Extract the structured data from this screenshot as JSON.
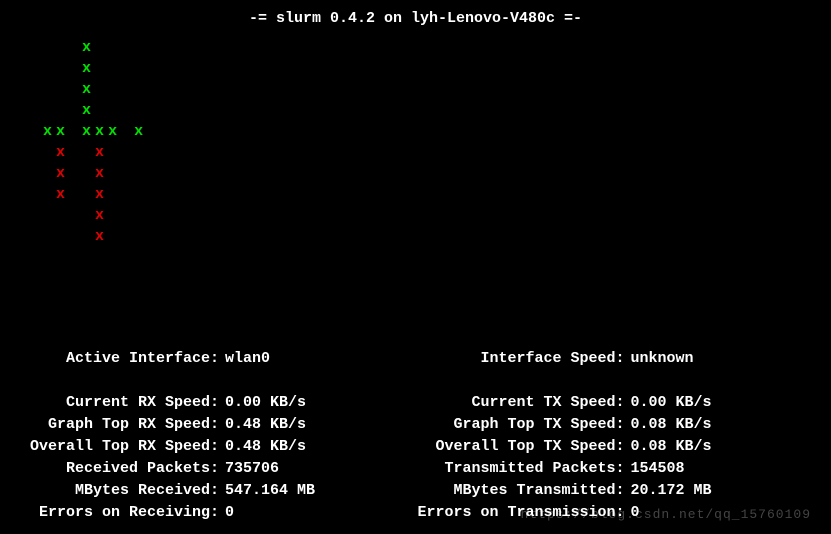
{
  "title": "-= slurm 0.4.2 on lyh-Lenovo-V480c =-",
  "graph": {
    "rx_rows": [
      [
        0,
        0,
        0,
        0,
        1,
        0,
        0
      ],
      [
        0,
        0,
        0,
        0,
        1,
        0,
        0
      ],
      [
        0,
        0,
        0,
        0,
        1,
        0,
        0
      ],
      [
        0,
        0,
        0,
        0,
        1,
        0,
        0
      ],
      [
        0,
        1,
        1,
        0,
        1,
        1,
        1,
        0,
        1
      ]
    ],
    "tx_rows": [
      [
        0,
        0,
        1,
        0,
        0,
        1
      ],
      [
        0,
        0,
        1,
        0,
        0,
        1
      ],
      [
        0,
        0,
        1,
        0,
        0,
        1
      ],
      [
        0,
        0,
        0,
        0,
        0,
        1
      ],
      [
        0,
        0,
        0,
        0,
        0,
        1
      ]
    ]
  },
  "stats_left": {
    "active_interface": {
      "label": "Active Interface:",
      "value": "wlan0"
    },
    "current_rx": {
      "label": "Current RX Speed:",
      "value": "0.00 KB/s"
    },
    "graph_top_rx": {
      "label": "Graph Top RX Speed:",
      "value": "0.48 KB/s"
    },
    "overall_top_rx": {
      "label": "Overall Top RX Speed:",
      "value": "0.48 KB/s"
    },
    "received_packets": {
      "label": "Received Packets:",
      "value": "735706"
    },
    "mbytes_received": {
      "label": "MBytes Received:",
      "value": "547.164 MB"
    },
    "errors_rx": {
      "label": "Errors on Receiving:",
      "value": "0"
    }
  },
  "stats_right": {
    "interface_speed": {
      "label": "Interface Speed:",
      "value": "unknown"
    },
    "current_tx": {
      "label": "Current TX Speed:",
      "value": "0.00 KB/s"
    },
    "graph_top_tx": {
      "label": "Graph Top TX Speed:",
      "value": "0.08 KB/s"
    },
    "overall_top_tx": {
      "label": "Overall Top TX Speed:",
      "value": "0.08 KB/s"
    },
    "transmitted_packets": {
      "label": "Transmitted Packets:",
      "value": "154508"
    },
    "mbytes_transmitted": {
      "label": "MBytes Transmitted:",
      "value": "20.172 MB"
    },
    "errors_tx": {
      "label": "Errors on Transmission:",
      "value": "0"
    }
  },
  "watermark": "https://blog.csdn.net/qq_15760109"
}
